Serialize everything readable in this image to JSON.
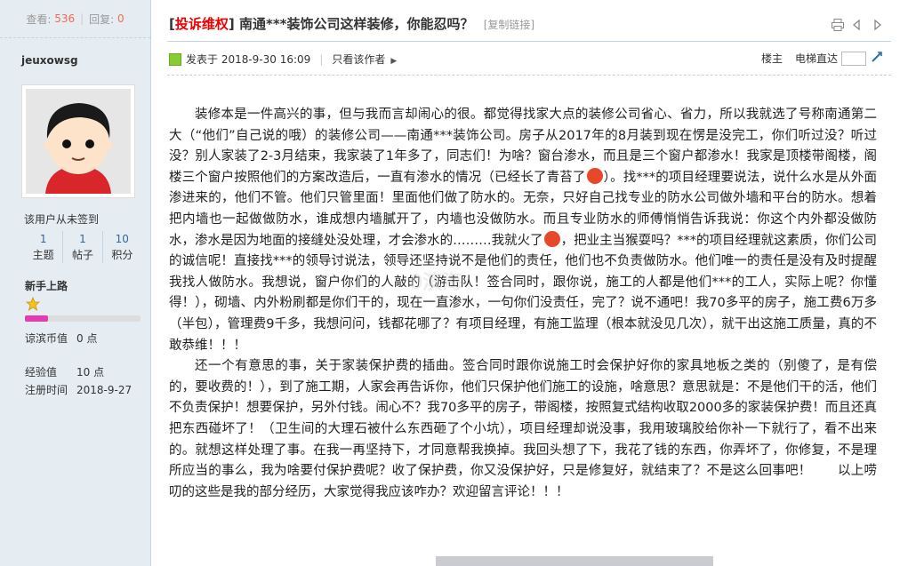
{
  "sidebar": {
    "views_label": "查看:",
    "views": "536",
    "replies_label": "回复:",
    "replies": "0",
    "username": "jeuxowsg",
    "signin_status": "该用户从未签到",
    "stats": [
      {
        "value": "1",
        "label": "主题"
      },
      {
        "value": "1",
        "label": "帖子"
      },
      {
        "value": "10",
        "label": "积分"
      }
    ],
    "level": "新手上路",
    "level_progress": 0.2,
    "coins_label": "谅滨币值",
    "coins_value": "0 点",
    "exp_label": "经验值",
    "exp_value": "10 点",
    "reg_label": "注册时间",
    "reg_value": "2018-9-27"
  },
  "post": {
    "tag": "投诉维权",
    "bracket_open": "[",
    "bracket_close": "]",
    "title": "南通***装饰公司这样装修，你能忍吗？",
    "copy_link": "[复制链接]",
    "posted_at": "发表于 2018-9-30 16:09",
    "only_author": "只看该作者",
    "floor": "楼主",
    "jump_label": "电梯直达",
    "watermark": "0滨海",
    "paragraphs": [
      "装修本是一件高兴的事，但与我而言却闹心的很。都觉得找家大点的装修公司省心、省力，所以我就选了号称南通第二大（“他们”自己说的哦）的装修公司——南通***装饰公司。房子从2017年的8月装到现在愣是没完工，你们听过没？听过没？别人家装了2-3月结束，我家装了1年多了，同志们！为啥？窗台渗水，而且是三个窗户都渗水！我家是顶楼带阁楼，阁楼三个窗户按照他们的方案改造后，一直有渗水的情况（已经长了青苔了",
      "）。找***的项目经理要说法，说什么水是从外面渗进来的，他们不管。他们只管里面！里面他们做了防水的。无奈，只好自己找专业的防水公司做外墙和平台的防水。想着把内墙也一起做做防水，谁成想内墙膩开了，内墙也没做防水。而且专业防水的师傅悄悄告诉我说：你这个内外都没做防水，渗水是因为地面的接缝处没处理，才会渗水的………我就火了",
      "，把业主当猴耍吗？***的项目经理就这素质，你们公司的诚信呢！直接找***的领导讨说法，领导还坚持说不是他们的责任，他们也不负责做防水。他们唯一的责任是没有及时提醒我找人做防水。我想说，窗户你们的人敲的（游击队！签合同时，跟你说，施工的人都是他们***的工人，实际上呢？你懂得！），砌墙、内外粉刷都是你们干的，现在一直渗水，一句你们没责任，完了？说不通吧！我70多平的房子，施工费6万多（半包），管理费9千多，我想问问，钱都花哪了？有项目经理，有施工监理（根本就没见几次），就干出这施工质量，真的不敢恭维！！！",
      "还一个有意思的事，关于家装保护费的插曲。签合同时跟你说施工时会保护好你的家具地板之类的（别傻了，是有偿的，要收费的！），到了施工期，人家会再告诉你，他们只保护他们施工的设施，啥意思？意思就是：不是他们干的活，他们不负责保护！想要保护，另外付钱。闹心不？我70多平的房子，带阁楼，按照复式结构收取2000多的家装保护费！而且还真把东西碰坏了！（卫生间的大理石被什么东西砸了个小坑），项目经理却说没事，我用玻璃胶给你补一下就行了，看不出来的。就想这样处理了事。在我一再坚持下，才同意帮我换掉。我回头想了下，我花了钱的东西，你弄坏了，你修复，不是理所应当的事么，我为啥要付保护费呢？收了保护费，你又没保护好，只是修复好，就结束了？不是这么回事吧！　　以上唠叨的这些是我的部分经历，大家觉得我应该咋办？欢迎留言评论！！！"
    ],
    "emoji_names": [
      "angry-face-icon",
      "angry-face-icon"
    ]
  }
}
